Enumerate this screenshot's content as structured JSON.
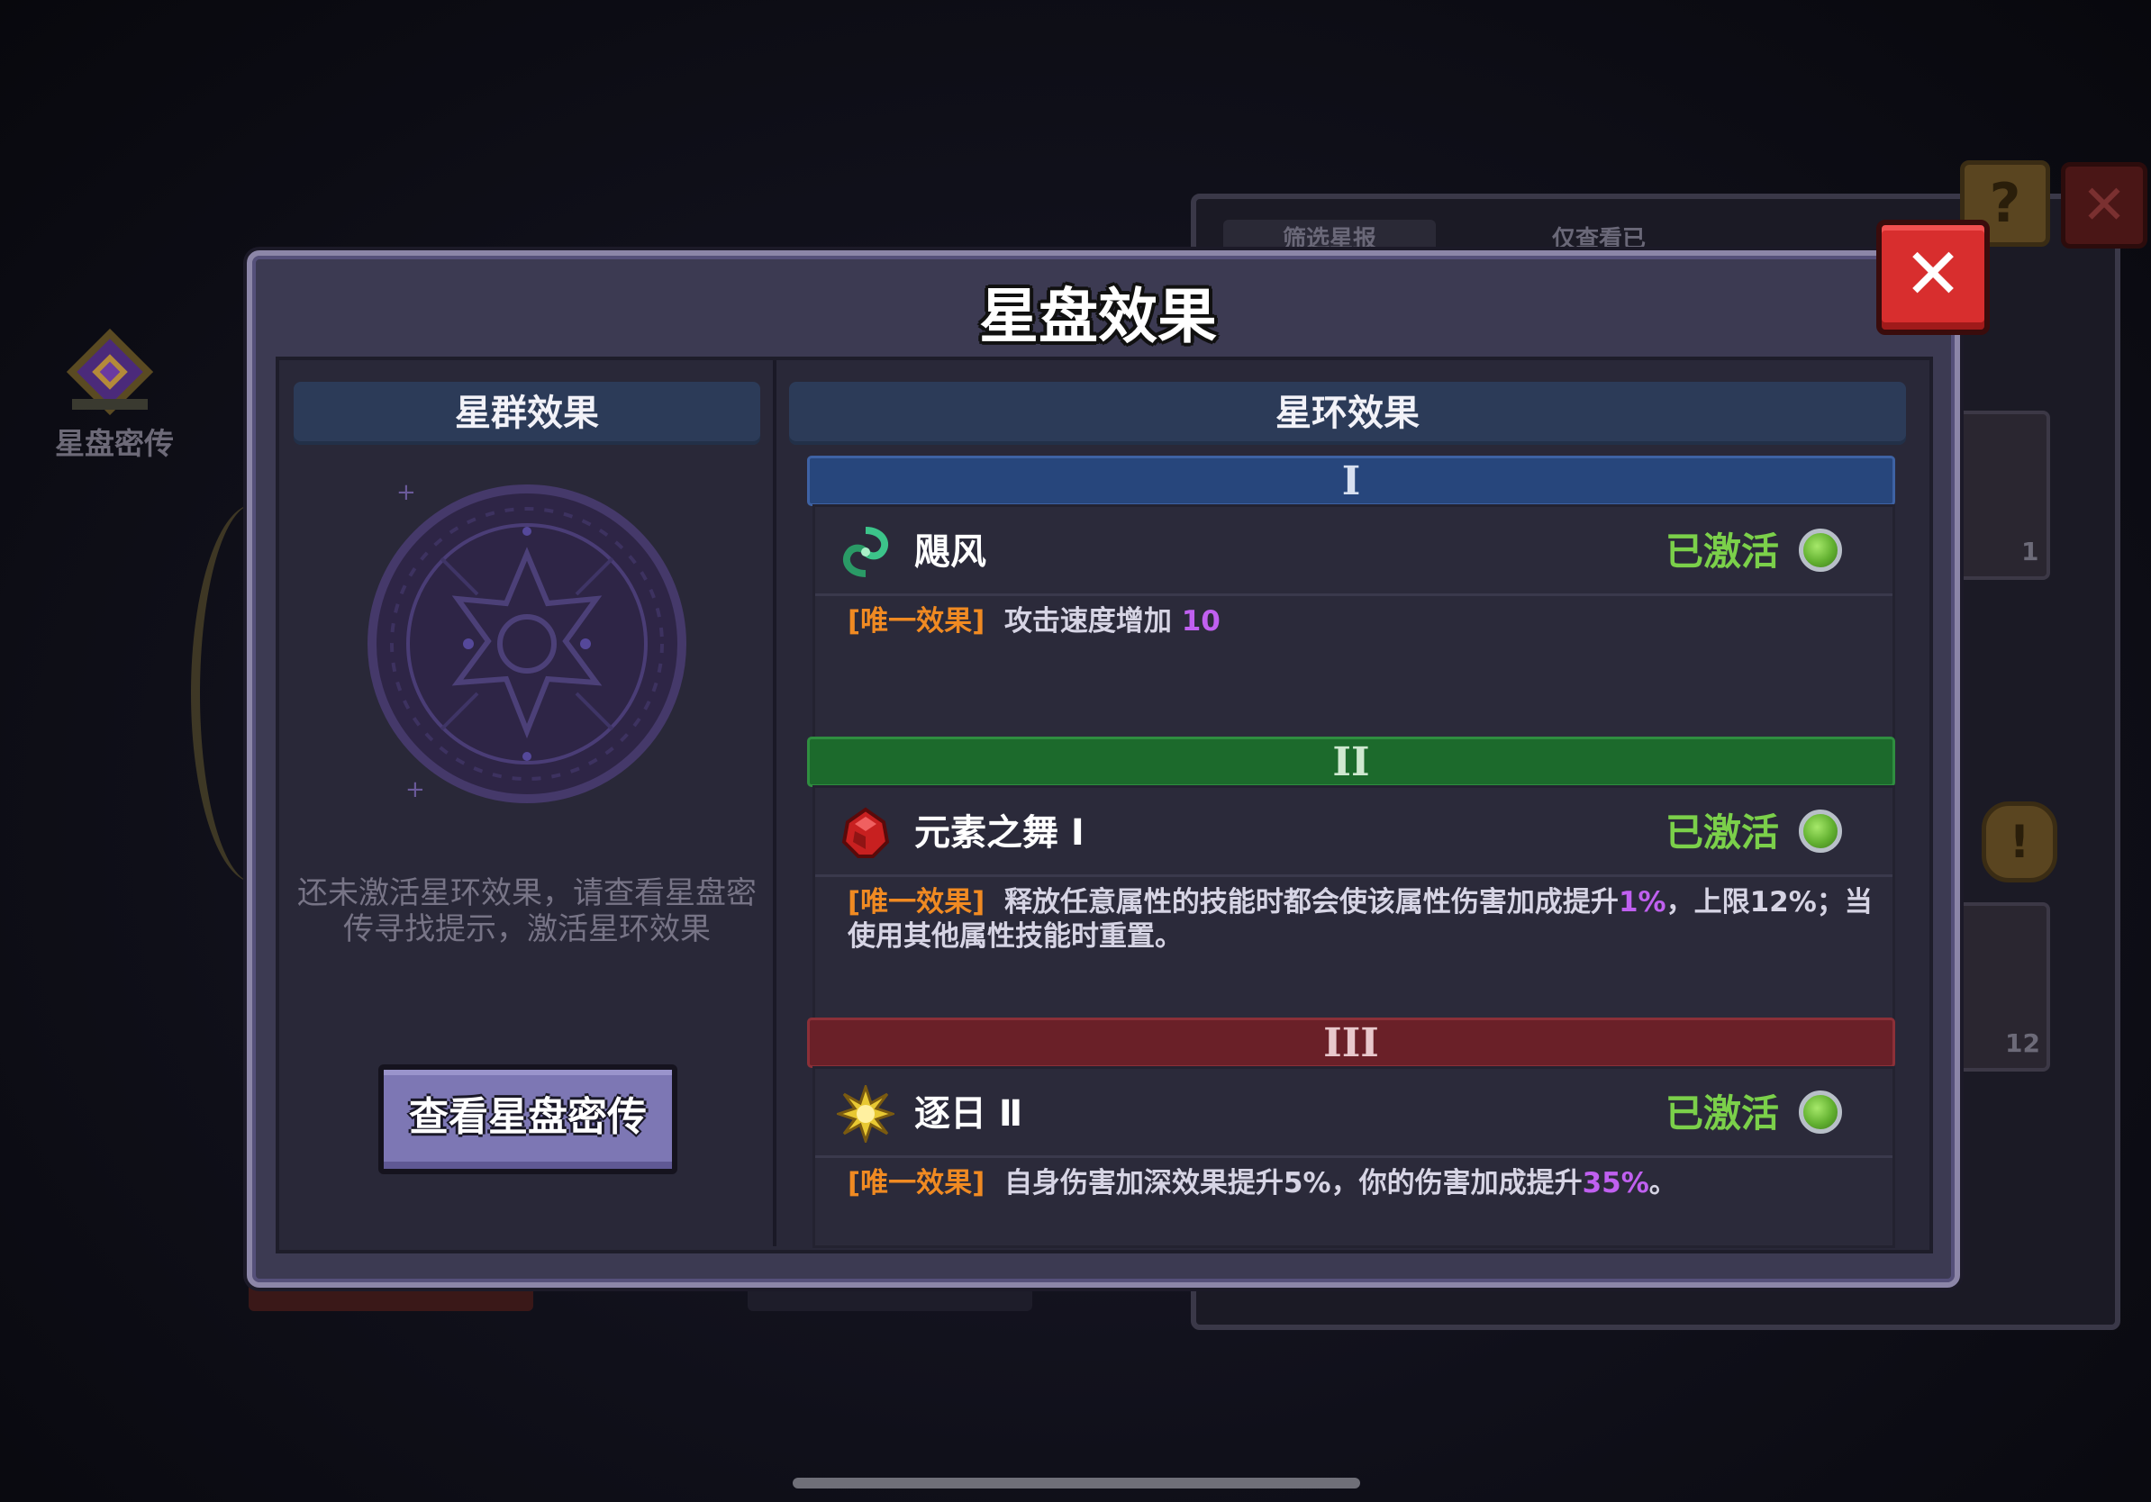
{
  "background": {
    "left_label": "星盘密传",
    "filter_tab": "筛选星报",
    "only_view_tab": "仅查看已",
    "slot_counts": [
      "1",
      "12"
    ]
  },
  "dialog": {
    "title": "星盘效果",
    "left_header": "星群效果",
    "right_header": "星环效果",
    "hint": "还未激活星环效果，请查看星盘密传寻找提示，激活星环效果",
    "view_button": "查看星盘密传",
    "tiers": [
      {
        "numeral": "I",
        "color": "#27467c",
        "name": "飓风",
        "icon": "cyclone-icon",
        "status": "已激活",
        "tag": "[唯一效果]",
        "desc_parts": [
          "攻击速度增加 ",
          "10",
          ""
        ]
      },
      {
        "numeral": "II",
        "color": "#1c6a2c",
        "name": "元素之舞 Ⅰ",
        "icon": "red-crystal-icon",
        "status": "已激活",
        "tag": "[唯一效果]",
        "desc_parts": [
          "释放任意属性的技能时都会使该属性伤害加成提升",
          "1%",
          "，上限12%；当使用其他属性技能时重置。"
        ]
      },
      {
        "numeral": "III",
        "color": "#6a2028",
        "name": "逐日 Ⅱ",
        "icon": "sun-icon",
        "status": "已激活",
        "tag": "[唯一效果]",
        "desc_parts": [
          "自身伤害加深效果提升5%，你的伤害加成提升",
          "35%",
          "。"
        ]
      }
    ]
  },
  "colors": {
    "active_status": "#7bd04a",
    "tag": "#f08a22",
    "highlight": "#c060f0",
    "close_button": "#d82e2e"
  }
}
